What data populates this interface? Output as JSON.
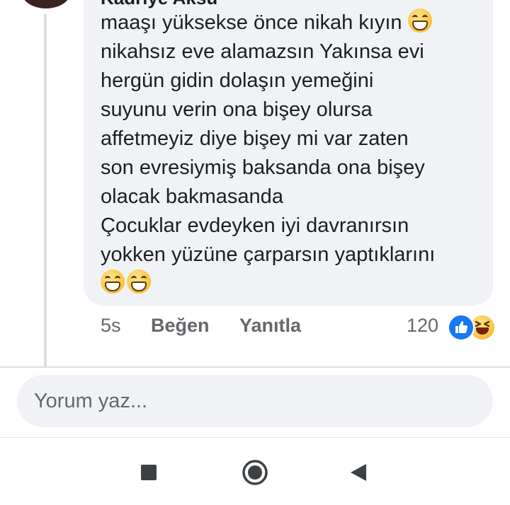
{
  "comment": {
    "author": "Kadriye Aksu",
    "lines": [
      "maaşı yüksekse önce nikah kıyın",
      "nikahsız eve alamazsın Yakınsa evi",
      "hergün gidin dolaşın yemeğini",
      "suyunu verin ona bişey olursa",
      "affetmeyiz diye bişey mi var zaten",
      "son evresiymiş baksanda ona bişey",
      "olacak bakmasanda",
      "Çocuklar evdeyken iyi davranırsın",
      "yokken yüzüne çarparsın yaptıklarını"
    ],
    "emoji": "grinning-face-with-smiling-eyes",
    "time": "5s",
    "like_label": "Beğen",
    "reply_label": "Yanıtla",
    "reaction_count": "120",
    "reactions": [
      "like-icon",
      "haha-icon"
    ]
  },
  "composer": {
    "placeholder": "Yorum yaz..."
  },
  "nav": {
    "buttons": [
      "recents",
      "home",
      "back"
    ]
  },
  "colors": {
    "bubble": "#f0f2f5",
    "text": "#1c1e21",
    "secondary_text": "#65676b",
    "like_blue": "#1877f2"
  }
}
